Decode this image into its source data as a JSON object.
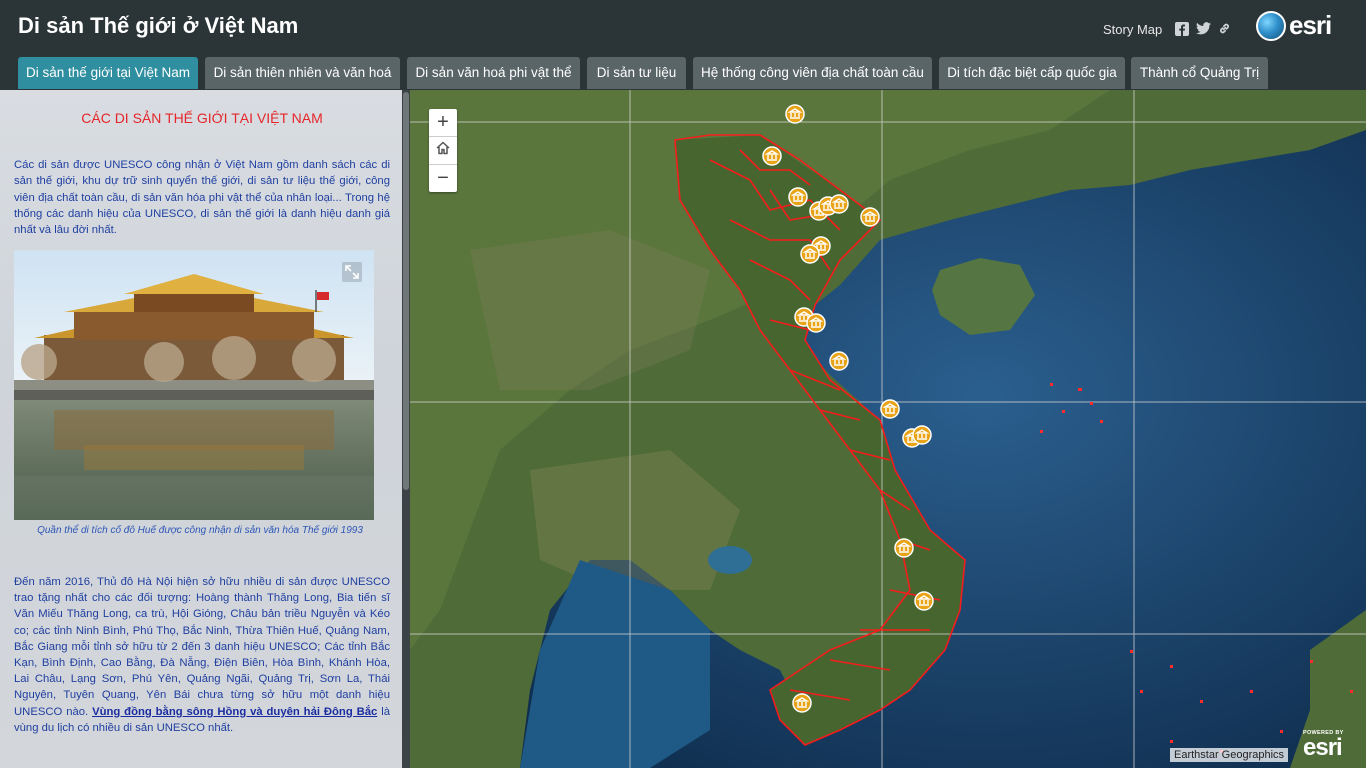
{
  "header": {
    "title": "Di sản Thế giới ở Việt Nam",
    "story_map_label": "Story Map",
    "brand": "esri"
  },
  "tabs": [
    {
      "label": "Di sản thế giới tại Việt Nam",
      "active": true
    },
    {
      "label": "Di sản thiên nhiên và văn hoá",
      "active": false
    },
    {
      "label": "Di sản văn hoá phi vật thể",
      "active": false
    },
    {
      "label": "Di sản tư liệu",
      "active": false
    },
    {
      "label": "Hệ thống công viên địa chất toàn cầu",
      "active": false
    },
    {
      "label": "Di tích đặc biệt cấp quốc gia",
      "active": false
    },
    {
      "label": "Thành cổ Quảng Trị",
      "active": false
    }
  ],
  "side": {
    "heading": "CÁC DI SẢN THẾ GIỚI TẠI VIỆT NAM",
    "intro": "Các di sản được UNESCO công nhận ở Việt Nam gồm danh sách các di sản thế giới, khu dự trữ sinh quyển thế giới, di sản tư liệu thế giới, công viên địa chất toàn cầu, di sản văn hóa phi vật thể của nhân loại... Trong hệ thống các danh hiệu của UNESCO, di sản thế giới là danh hiệu danh giá nhất và lâu đời nhất.",
    "photo_caption": "Quần thể di tích cố đô Huế được công nhận di sản văn hóa Thế giới 1993",
    "body_before_link": "Đến năm 2016, Thủ đô Hà Nội hiện sở hữu nhiều di sản được UNESCO trao tặng nhất cho các đối tượng: Hoàng thành Thăng Long, Bia tiến sĩ Văn Miếu Thăng Long, ca trù, Hội Gióng, Châu bản triều Nguyễn và Kéo co; các tỉnh Ninh Bình, Phú Thọ, Bắc Ninh, Thừa Thiên Huế, Quảng Nam, Bắc Giang mỗi tỉnh sở hữu từ 2 đến 3 danh hiệu UNESCO; Các tỉnh Bắc Kạn, Bình Định, Cao Bằng, Đà Nẵng, Điện Biên, Hòa Bình, Khánh Hòa, Lai Châu, Lạng Sơn, Phú Yên, Quảng Ngãi, Quảng Trị, Sơn La, Thái Nguyên, Tuyên Quang, Yên Bái chưa từng sở hữu một danh hiệu UNESCO nào. ",
    "body_link": "Vùng đồng bằng sông Hồng và duyên hải Đông Bắc",
    "body_after_link": " là vùng du lịch có nhiều di sản UNESCO nhất."
  },
  "map": {
    "zoom_in": "+",
    "zoom_out": "−",
    "attribution": "Earthstar Geographics",
    "powered_by": "POWERED BY",
    "powered_brand": "esri",
    "marker_count": 24
  },
  "icons": {
    "facebook": "facebook-icon",
    "twitter": "twitter-icon",
    "link": "link-icon",
    "home": "home-icon",
    "expand": "expand-icon",
    "marker": "museum-marker-icon"
  },
  "colors": {
    "header_bg": "#2b3437",
    "tab_active": "#2f8e9f",
    "tab_inactive": "#5a6568",
    "heading_red": "#e4262b",
    "text_blue": "#1f3fa0",
    "boundary_red": "#ff1a1a",
    "marker_gold": "#e8a317"
  }
}
